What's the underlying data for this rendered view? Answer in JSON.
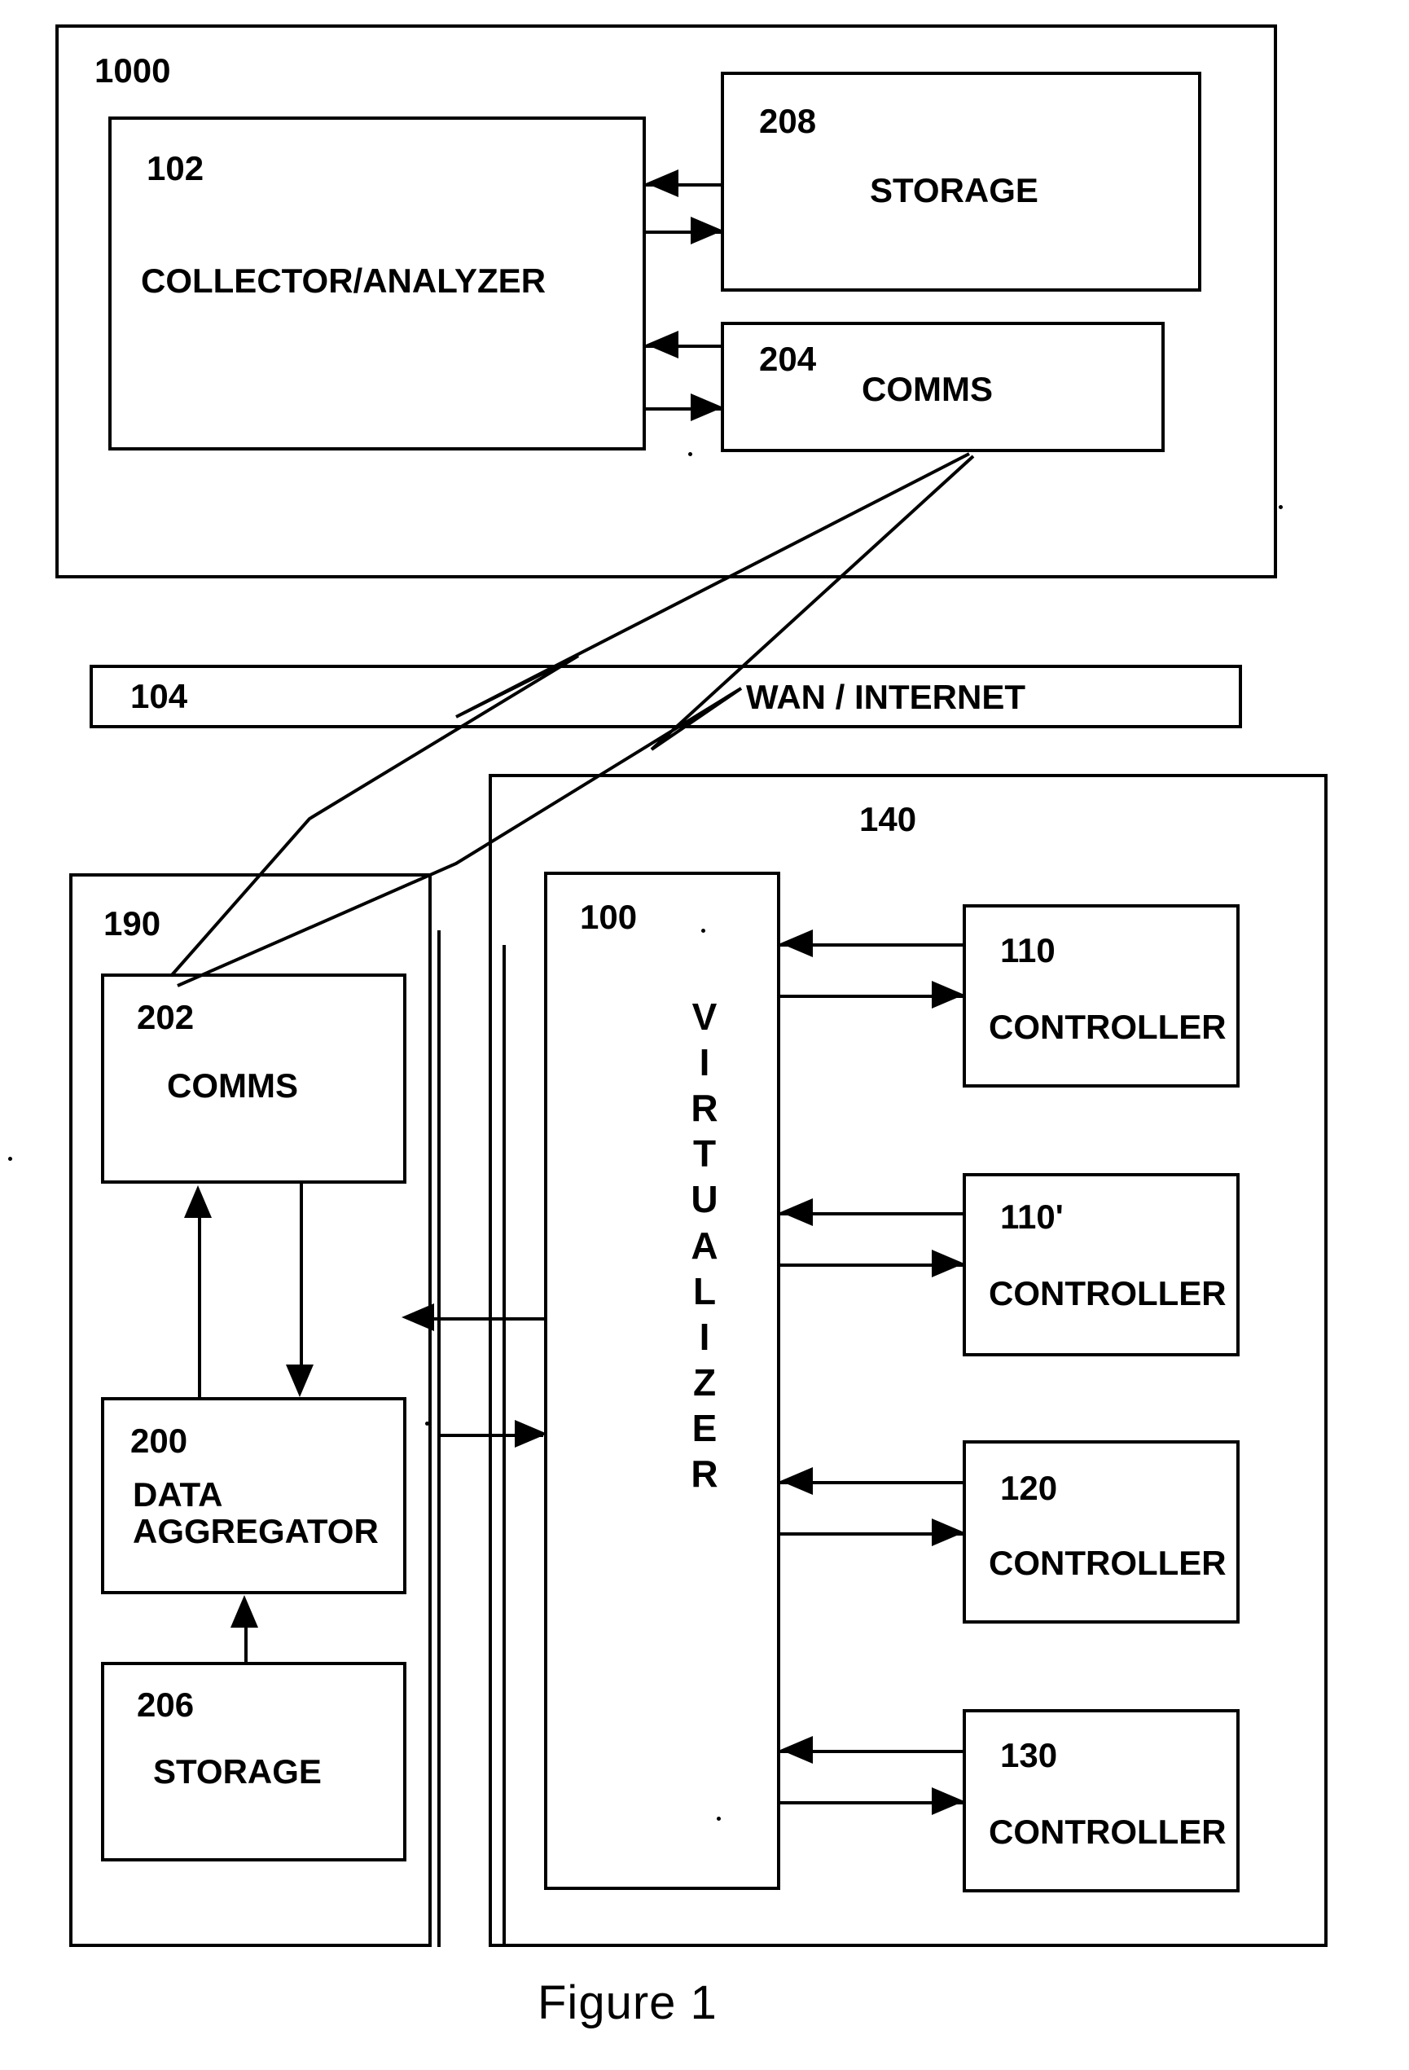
{
  "figure": {
    "caption": "Figure 1"
  },
  "top_system": {
    "ref": "1000",
    "collector": {
      "ref": "102",
      "label": "COLLECTOR/ANALYZER"
    },
    "storage": {
      "ref": "208",
      "label": "STORAGE"
    },
    "comms": {
      "ref": "204",
      "label": "COMMS"
    }
  },
  "network": {
    "ref": "104",
    "label": "WAN / INTERNET"
  },
  "site": {
    "ref": "140",
    "virtualizer": {
      "ref": "100",
      "label": "VIRTUALIZER",
      "letters": [
        "V",
        "I",
        "R",
        "T",
        "U",
        "A",
        "L",
        "I",
        "Z",
        "E",
        "R"
      ]
    },
    "controllers": [
      {
        "ref": "110",
        "label": "CONTROLLER"
      },
      {
        "ref": "110'",
        "label": "CONTROLLER"
      },
      {
        "ref": "120",
        "label": "CONTROLLER"
      },
      {
        "ref": "130",
        "label": "CONTROLLER"
      }
    ]
  },
  "appliance": {
    "ref": "190",
    "comms": {
      "ref": "202",
      "label": "COMMS"
    },
    "aggregator": {
      "ref": "200",
      "label_line1": "DATA",
      "label_line2": "AGGREGATOR"
    },
    "storage": {
      "ref": "206",
      "label": "STORAGE"
    }
  },
  "colors": {
    "ink": "#000000",
    "paper": "#ffffff"
  }
}
